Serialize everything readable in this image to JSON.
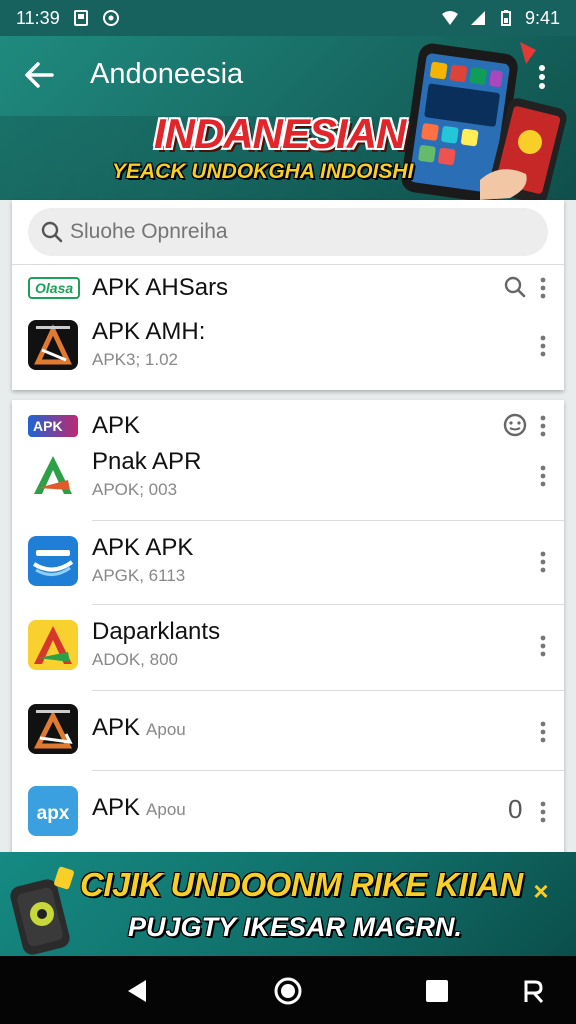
{
  "status_bar": {
    "time": "11:39",
    "clock_right": "9:41"
  },
  "app_bar": {
    "title": "Andoneesia"
  },
  "banner": {
    "title": "INDANESIAN",
    "subtitle": "YEACK UNDOKGHA INDOISHI"
  },
  "search": {
    "placeholder": "Sluohe Opnreiha"
  },
  "section_1": {
    "badge": "Olasa",
    "title": "APK AHSars",
    "apps": [
      {
        "name": "APK AMH:",
        "meta": "APK3; 1.02",
        "icon": "apk-dark-icon"
      }
    ]
  },
  "section_2": {
    "badge": "APK",
    "title": "APK",
    "apps": [
      {
        "name": "Pnak APR",
        "meta": "APOK; 003",
        "icon": "apk-green-triangle-icon"
      },
      {
        "name": "APK APK",
        "meta": "APGK, 6113",
        "icon": "apk-blue-icon"
      },
      {
        "name": "Daparklants",
        "meta": "ADOK, 800",
        "icon": "apk-yellow-icon"
      },
      {
        "name": "APK",
        "sub": "Apou",
        "icon": "apk-dark-arrow-icon"
      },
      {
        "name": "APK",
        "sub": "Apou",
        "badge": "0",
        "icon": "apx-icon",
        "icon_text": "apx"
      }
    ]
  },
  "ad": {
    "line1": "CIJIK UNDOONM RIKE KIIAN",
    "line2": "PUJGTY IKESAR MAGRN.",
    "close": "×"
  },
  "colors": {
    "header": "#17615e",
    "accent_red": "#e0262b",
    "accent_yellow": "#f8ce28"
  }
}
